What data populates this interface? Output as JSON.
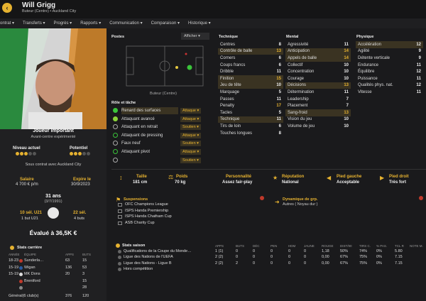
{
  "header": {
    "name": "Will Grigg",
    "subtitle": "Buteur (Centre) • Auckland City"
  },
  "menu": [
    "ontrat ▾",
    "Transferts ▾",
    "Progrès ▾",
    "Rapports ▾",
    "Communication ▾",
    "Comparaison ▾",
    "Historique ▾"
  ],
  "profile": {
    "role": "Joueur important",
    "role_sub": "Avant-centre expérimenté",
    "level_label": "Niveau actuel",
    "potential_label": "Potentiel",
    "contract_text": "Sous contrat avec Auckland City",
    "salary_label": "Salaire",
    "salary": "4 700 € p/m",
    "expiry_label": "Expire le",
    "expiry": "30/9/2023",
    "age": "31 ans",
    "dob": "(3/7/1991)",
    "u21_label": "10 sél. U21",
    "u21_goals": "1 but U21",
    "caps": "22 sél.",
    "goals": "4 buts",
    "value": "Évalué à 36,5K €"
  },
  "career": {
    "title": "Stats carrière",
    "cols": [
      "ANNÉE",
      "ÉQUIPE",
      "APPS",
      "BUTS"
    ],
    "rows": [
      [
        "18-23",
        "Sunderla…",
        "63",
        "15"
      ],
      [
        "15-19",
        "Wigan",
        "136",
        "53"
      ],
      [
        "15-19",
        "MK Dons",
        "20",
        "3"
      ],
      [
        "",
        "Brentford",
        "",
        "15"
      ],
      [
        "",
        "",
        "",
        "28"
      ]
    ],
    "total": [
      "Général(6 club(s)",
      "376",
      "120"
    ]
  },
  "positions": {
    "title": "Postes",
    "show_btn": "Afficher",
    "position_name": "Buteur (Centre)"
  },
  "roles": {
    "title": "Rôle et tâche",
    "items": [
      [
        "Renard des surfaces",
        "Attaque"
      ],
      [
        "Attaquant avancé",
        "Attaque"
      ],
      [
        "Attaquant en retrait",
        "Soutien"
      ],
      [
        "Attaquant de pressing",
        "Attaque"
      ],
      [
        "Faux neuf",
        "Soutien"
      ],
      [
        "Attaquant pivot",
        "Attaque"
      ],
      [
        "",
        "Soutien"
      ]
    ]
  },
  "technique": {
    "title": "Technique",
    "items": [
      [
        "Centres",
        "8"
      ],
      [
        "Contrôle de balle",
        "13"
      ],
      [
        "Corners",
        "6"
      ],
      [
        "Coups francs",
        "6"
      ],
      [
        "Dribble",
        "11"
      ],
      [
        "Finition",
        "15"
      ],
      [
        "Jeu de tête",
        "10"
      ],
      [
        "Marquage",
        "5"
      ],
      [
        "Passes",
        "11"
      ],
      [
        "Penalty",
        "17"
      ],
      [
        "Tacles",
        "5"
      ],
      [
        "Technique",
        "11"
      ],
      [
        "Tirs de loin",
        "6"
      ],
      [
        "Touches longues",
        "8"
      ]
    ]
  },
  "mental": {
    "title": "Mental",
    "items": [
      [
        "Agressivité",
        "11"
      ],
      [
        "Anticipation",
        "14"
      ],
      [
        "Appels de balle",
        "14"
      ],
      [
        "Collectif",
        "10"
      ],
      [
        "Concentration",
        "10"
      ],
      [
        "Courage",
        "10"
      ],
      [
        "Décisions",
        "13"
      ],
      [
        "Détermination",
        "11"
      ],
      [
        "Leadership",
        "7"
      ],
      [
        "Placement",
        "7"
      ],
      [
        "Sang-froid",
        "13"
      ],
      [
        "Vision du jeu",
        "10"
      ],
      [
        "Volume de jeu",
        "10"
      ]
    ]
  },
  "physique": {
    "title": "Physique",
    "items": [
      [
        "Accélération",
        "12"
      ],
      [
        "Agilité",
        "9"
      ],
      [
        "Détente verticale",
        "9"
      ],
      [
        "Endurance",
        "11"
      ],
      [
        "Équilibre",
        "12"
      ],
      [
        "Puissance",
        "11"
      ],
      [
        "Qualités phys. nat.",
        "12"
      ],
      [
        "Vitesse",
        "11"
      ]
    ]
  },
  "info": {
    "height_label": "Taille",
    "height": "181 cm",
    "weight_label": "Poids",
    "weight": "70 kg",
    "personality_label": "Personnalité",
    "personality": "Assez fair-play",
    "reputation_label": "Réputation",
    "reputation": "National",
    "left_foot_label": "Pied gauche",
    "left_foot": "Acceptable",
    "right_foot_label": "Pied droit",
    "right_foot": "Très fort"
  },
  "suspensions": {
    "title": "Suspensions",
    "items": [
      "OFC Champions League",
      "ISPS Handa Premiership",
      "ISPS Handa Chatham Cup",
      "ASB Charity Cup"
    ]
  },
  "dynamics": {
    "title": "Dynamique de grp.",
    "value": "Autres ( Noyau dur )"
  },
  "season": {
    "title": "Stats saison",
    "cols": [
      "APPS",
      "BUTS",
      "DÉC",
      "PEN",
      "HDM",
      "JAUNE",
      "ROUGE",
      "DIST/90",
      "TIRS C.",
      "% PAS.",
      "TCL R",
      "NOTE M."
    ],
    "rows": [
      [
        "Qualifications de la Coupe du Monde…",
        "1 (1)",
        "0",
        "0",
        "0",
        "0",
        "0",
        "1,18",
        "50%",
        "74%",
        "0%",
        "5.80"
      ],
      [
        "Ligue des Nations de l'UEFA",
        "2 (2)",
        "0",
        "0",
        "0",
        "0",
        "0",
        "0,00",
        "67%",
        "75%",
        "0%",
        "7.15"
      ],
      [
        "Ligue des Nations - Ligue B",
        "2 (2)",
        "2",
        "0",
        "0",
        "0",
        "0",
        "0,00",
        "67%",
        "75%",
        "0%",
        "7.15"
      ],
      [
        "Hors compétition",
        "",
        "",
        "",
        "",
        "",
        "",
        "",
        "",
        "",
        "",
        ""
      ]
    ],
    "note_colors": [
      "#c0392b",
      "#3a7d2a",
      "#3a7d2a"
    ]
  }
}
